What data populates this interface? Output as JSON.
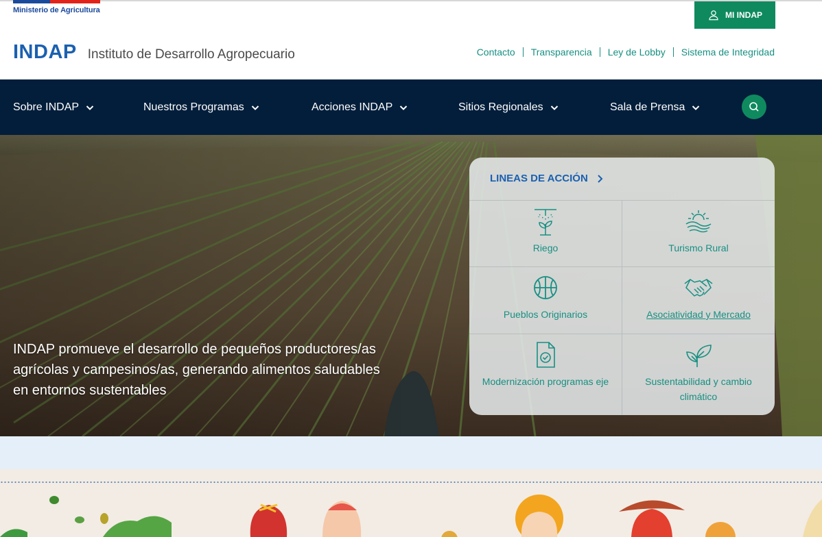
{
  "ministry": {
    "label": "Ministerio de Agricultura"
  },
  "header": {
    "logo": "INDAP",
    "subtitle": "Instituto de Desarrollo Agropecuario",
    "login_button": "MI INDAP",
    "links": [
      "Contacto",
      "Transparencia",
      "Ley de Lobby",
      "Sistema de Integridad"
    ]
  },
  "nav": {
    "items": [
      {
        "label": "Sobre INDAP"
      },
      {
        "label": "Nuestros Programas"
      },
      {
        "label": "Acciones INDAP"
      },
      {
        "label": "Sitios Regionales"
      },
      {
        "label": "Sala de Prensa"
      }
    ],
    "search_icon": "search-icon"
  },
  "hero": {
    "text": "INDAP promueve el desarrollo de pequeños productores/as agrícolas y campesinos/as, generando alimentos saludables en entornos sustentables"
  },
  "lineas": {
    "title": "LINEAS DE ACCIÓN",
    "items": [
      {
        "label": "Riego",
        "icon": "irrigation-sprout-icon"
      },
      {
        "label": "Turismo Rural",
        "icon": "rural-landscape-icon"
      },
      {
        "label": "Pueblos Originarios",
        "icon": "woven-basket-icon"
      },
      {
        "label": "Asociatividad y Mercado",
        "icon": "handshake-icon"
      },
      {
        "label": "Modernización programas eje",
        "icon": "document-check-icon"
      },
      {
        "label": "Sustentabilidad y cambio climático",
        "icon": "leaves-sprout-icon"
      }
    ]
  },
  "colors": {
    "brand_blue": "#1b60b0",
    "nav_bg": "#031e3b",
    "accent_green": "#0f8a5f",
    "link_teal": "#178f82"
  }
}
